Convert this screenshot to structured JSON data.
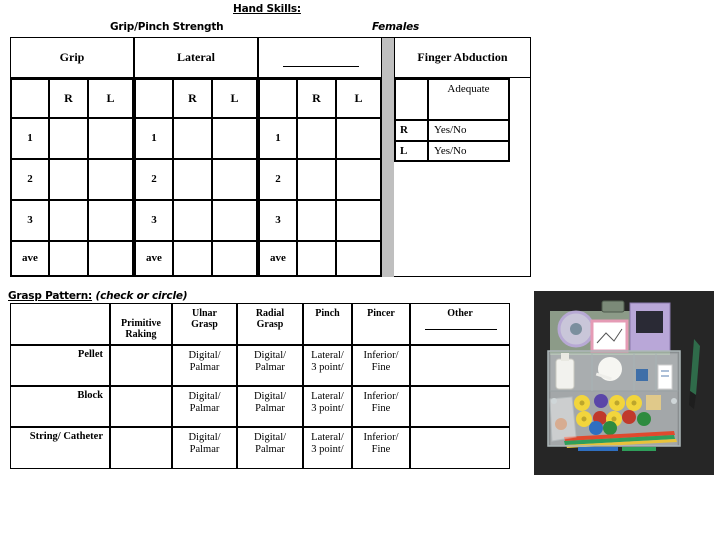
{
  "page": {
    "title": "Hand Skills:",
    "subtitle_left": "Grip/Pinch Strength",
    "subtitle_right": "Females"
  },
  "strength_table": {
    "group_headers": [
      {
        "label": "Grip",
        "has_blank_line": false
      },
      {
        "label": "Lateral",
        "has_blank_line": false
      },
      {
        "label": "",
        "has_blank_line": true
      },
      {
        "label": "Finger Abduction",
        "has_blank_line": false
      }
    ],
    "column_headers": [
      "",
      "R",
      "L"
    ],
    "trial_labels": [
      "1",
      "2",
      "3",
      "ave"
    ],
    "finger_abduction": {
      "header": "Finger Abduction",
      "col_label": "Adequate",
      "rows": [
        {
          "side": "R",
          "value": "Yes/No"
        },
        {
          "side": "L",
          "value": "Yes/No"
        }
      ]
    }
  },
  "grasp_section": {
    "label": "Grasp Pattern:",
    "instruction": "(check or circle)",
    "headers": [
      "",
      "Primitive Raking",
      "Ulnar Grasp",
      "Radial Grasp",
      "Pinch",
      "Pincer",
      "Other"
    ],
    "header_parts": {
      "primitive": [
        "Primitive",
        "Raking"
      ],
      "ulnar": [
        "Ulnar",
        "Grasp"
      ],
      "radial": [
        "Radial",
        "Grasp"
      ],
      "pinch": [
        "Pinch"
      ],
      "pincer": [
        "Pincer"
      ],
      "other": [
        "Other"
      ]
    },
    "rows": [
      {
        "label": "Pellet",
        "primitive": "",
        "ulnar": [
          "Digital/",
          "Palmar"
        ],
        "radial": [
          "Digital/",
          "Palmar"
        ],
        "pinch": [
          "Lateral/",
          "3 point/"
        ],
        "pincer": [
          "Inferior/",
          "Fine"
        ],
        "other": ""
      },
      {
        "label": "Block",
        "primitive": "",
        "ulnar": [
          "Digital/",
          "Palmar"
        ],
        "radial": [
          "Digital/",
          "Palmar"
        ],
        "pinch": [
          "Lateral/",
          "3 point/"
        ],
        "pincer": [
          "Inferior/",
          "Fine"
        ],
        "other": ""
      },
      {
        "label": "String/ Catheter",
        "primitive": "",
        "ulnar": [
          "Digital/",
          "Palmar"
        ],
        "radial": [
          "Digital/",
          "Palmar"
        ],
        "pinch": [
          "Lateral/",
          "3 point/"
        ],
        "pincer": [
          "Inferior/",
          "Fine"
        ],
        "other": ""
      }
    ]
  },
  "photo": {
    "caption": "assessment-kit-toolbox-photo",
    "background_color": "#262626"
  },
  "colors": {
    "ink": "#000000",
    "divider_gray": "#bfbfbf",
    "page": "#ffffff"
  }
}
